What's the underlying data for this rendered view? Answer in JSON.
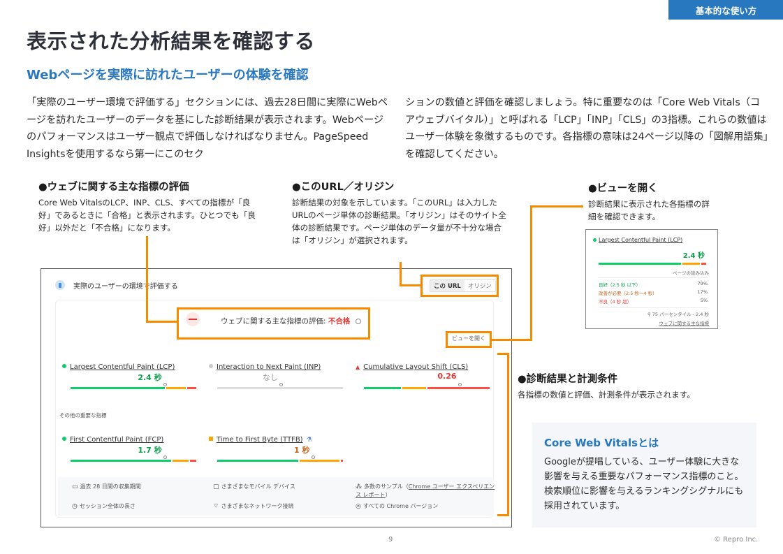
{
  "header": {
    "section_tag": "基本的な使い方",
    "title": "表示された分析結果を確認する",
    "subtitle": "Webページを実際に訪れたユーザーの体験を確認"
  },
  "intro": {
    "left": "「実際のユーザー環境で評価する」セクションには、過去28日間に実際にWebページを訪れたユーザーのデータを基にした診断結果が表示されます。Webページのパフォーマンスはユーザー観点で評価しなければなりません。PageSpeed Insightsを使用するなら第一にこのセク",
    "right": "ションの数値と評価を確認しましょう。特に重要なのは「Core Web Vitals（コアウェブバイタル）」と呼ばれる「LCP」「INP」「CLS」の3指標。これらの数値はユーザー体験を象徴するものです。各指標の意味は24ページ以降の「図解用語集」を確認してください。"
  },
  "callouts": {
    "core_eval": {
      "heading": "●ウェブに関する主な指標の評価",
      "body": "Core Web VitalsのLCP、INP、CLS、すべての指標が「良好」であるときに「合格」と表示されます。ひとつでも「良好」以外だと「不合格」になります。"
    },
    "url_origin": {
      "heading": "●このURL／オリジン",
      "body": "診断結果の対象を示しています。「このURL」は入力したURLのページ単体の診断結果。「オリジン」はそのサイト全体の診断結果です。ページ単体のデータ量が不十分な場合は「オリジン」が選択されます。"
    },
    "open_view": {
      "heading": "●ビューを開く",
      "body": "診断結果に表示された各指標の詳細を確認できます。"
    },
    "results": {
      "heading": "●診断結果と計測条件",
      "body": "各指標の数値と評価、計測条件が表示されます。"
    }
  },
  "screenshot": {
    "section_title": "実際のユーザーの環境で評価する",
    "toggle": [
      "この URL",
      "オリジン"
    ],
    "assessment_label": "ウェブに関する主な指標の評価: ",
    "assessment_result": "不合格",
    "open_view_label": "ビューを開く",
    "other_metrics_label": "その他の重要な指標",
    "metrics": [
      {
        "name": "Largest Contentful Paint (LCP)",
        "value": "2.4 秒",
        "status": "good",
        "marker": 0.74,
        "segments": [
          0.75,
          0.17,
          0.08
        ]
      },
      {
        "name": "Interaction to Next Paint (INP)",
        "value": "なし",
        "status": "none",
        "marker": 0.5,
        "segments": [
          1.0
        ]
      },
      {
        "name": "Cumulative Layout Shift (CLS)",
        "value": "0.26",
        "status": "poor",
        "marker": 0.75,
        "segments": [
          0.3,
          0.2,
          0.5
        ]
      },
      {
        "name": "First Contentful Paint (FCP)",
        "value": "1.7 秒",
        "status": "good",
        "marker": 0.74,
        "segments": [
          0.8,
          0.14,
          0.06
        ]
      },
      {
        "name": "Time to First Byte (TTFB)",
        "value": "1 秒",
        "status": "ni",
        "marker": 0.75,
        "segments": [
          0.65,
          0.32,
          0.03
        ]
      }
    ],
    "conditions": [
      {
        "icon": "calendar-icon",
        "text": "過去 28 日間の収集期間"
      },
      {
        "icon": "devices-icon",
        "text": "さまざまなモバイル デバイス"
      },
      {
        "icon": "people-icon",
        "text": "多数のサンプル（",
        "link": "Chrome ユーザー エクスペリエンス レポート",
        "tail": "）"
      },
      {
        "icon": "timer-icon",
        "text": "セッション全体の長さ"
      },
      {
        "icon": "wifi-icon",
        "text": "さまざまなネットワーク接続"
      },
      {
        "icon": "chrome-icon",
        "text": "すべての Chrome バージョン"
      }
    ]
  },
  "lcp_panel": {
    "name": "Largest Contentful Paint (LCP)",
    "value": "2.4 秒",
    "caption": "ページの読み込み",
    "rows": [
      {
        "label": "良好（2.5 秒 以下）",
        "pct": "79%",
        "color": "#0c9f4c"
      },
      {
        "label": "改善が必要（2.5 秒〜4 秒）",
        "pct": "17%",
        "color": "#c5621a"
      },
      {
        "label": "不良（4 秒 超）",
        "pct": "5%",
        "color": "#e53935"
      }
    ],
    "percentile": "75 パーセンタイル - 2.4 秒",
    "link": "ウェブに関する主な指標"
  },
  "cwv_box": {
    "heading": "Core Web Vitalsとは",
    "body": "Googleが提唱している、ユーザー体験に大きな影響を与える重要なパフォーマンス指標のこと。検索順位に影響を与えるランキングシグナルにも採用されています。"
  },
  "footer": {
    "page_number": "9",
    "copyright": "© Repro Inc."
  },
  "colors": {
    "accent_blue": "#2878c0",
    "callout_orange": "#f78b00",
    "good": "#0cce6b",
    "needs_improvement": "#ffa400",
    "poor": "#ff4e42",
    "fail_red": "#e53935"
  }
}
